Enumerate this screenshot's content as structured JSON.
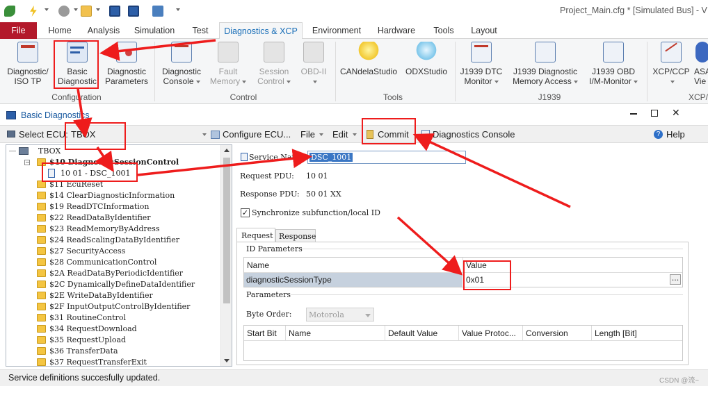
{
  "window": {
    "title": "Project_Main.cfg * [Simulated Bus] - V"
  },
  "ribbon_tabs": [
    "File",
    "Home",
    "Analysis",
    "Simulation",
    "Test",
    "Diagnostics & XCP",
    "Environment",
    "Hardware",
    "Tools",
    "Layout"
  ],
  "ribbon": {
    "configuration": {
      "label": "Configuration",
      "buttons": [
        "Diagnostic/\nISO TP",
        "Basic\nDiagnostic",
        "Diagnostic\nParameters"
      ]
    },
    "control": {
      "label": "Control",
      "buttons": [
        "Diagnostic\nConsole",
        "Fault\nMemory",
        "Session\nControl",
        "OBD-II"
      ]
    },
    "tools": {
      "label": "Tools",
      "buttons": [
        "CANdelaStudio",
        "ODXStudio"
      ]
    },
    "j1939": {
      "label": "J1939",
      "buttons": [
        "J1939 DTC\nMonitor",
        "J1939 Diagnostic\nMemory Access",
        "J1939 OBD\nI/M-Monitor"
      ]
    },
    "xcp": {
      "label": "XCP/",
      "buttons": [
        "XCP/CCP",
        "ASA\nVie"
      ]
    }
  },
  "panel": {
    "title": "Basic Diagnostics",
    "toolbar": {
      "select_ecu_label": "Select ECU:",
      "ecu_value": "TBOX",
      "configure_ecu": "Configure ECU...",
      "file": "File",
      "edit": "Edit",
      "commit": "Commit",
      "diagnostics_console": "Diagnostics Console",
      "help": "Help"
    },
    "tree": {
      "root": "TBOX",
      "expanded": "$10 DiagnosticSessionControl",
      "child": "10 01 - DSC_1001",
      "items": [
        "$11 EcuReset",
        "$14 ClearDiagnosticInformation",
        "$19 ReadDTCInformation",
        "$22 ReadDataByIdentifier",
        "$23 ReadMemoryByAddress",
        "$24 ReadScalingDataByIdentifier",
        "$27 SecurityAccess",
        "$28 CommunicationControl",
        "$2A ReadDataByPeriodicIdentifier",
        "$2C DynamicallyDefineDataIdentifier",
        "$2E WriteDataByIdentifier",
        "$2F InputOutputControlByIdentifier",
        "$31 RoutineControl",
        "$34 RequestDownload",
        "$35 RequestUpload",
        "$36 TransferData",
        "$37 RequestTransferExit"
      ]
    },
    "detail": {
      "service_name_label": "Service Name:",
      "service_name_value": "DSC_1001",
      "request_pdu_label": "Request PDU:",
      "request_pdu_value": "10 01",
      "response_pdu_label": "Response PDU:",
      "response_pdu_value": "50 01 XX",
      "sync_label": "Synchronize subfunction/local ID",
      "sync_checked": true,
      "tabs": [
        "Request",
        "Response"
      ],
      "id_params_label": "ID Parameters",
      "id_grid": {
        "columns": [
          "Name",
          "Value"
        ],
        "rows": [
          [
            "diagnosticSessionType",
            "0x01"
          ]
        ],
        "more_button": "..."
      },
      "params_label": "Parameters",
      "byte_order_label": "Byte Order:",
      "byte_order_value": "Motorola",
      "params_columns": [
        "Start Bit",
        "Name",
        "Default Value",
        "Value Protoc...",
        "Conversion",
        "Length [Bit]"
      ]
    },
    "status": "Service definitions succesfully updated."
  },
  "watermark": "CSDN @流~",
  "colors": {
    "accent": "#1a6fb8",
    "file_tab": "#b3192b",
    "annotation": "#ee1c1c",
    "selection": "#c6d1de"
  }
}
